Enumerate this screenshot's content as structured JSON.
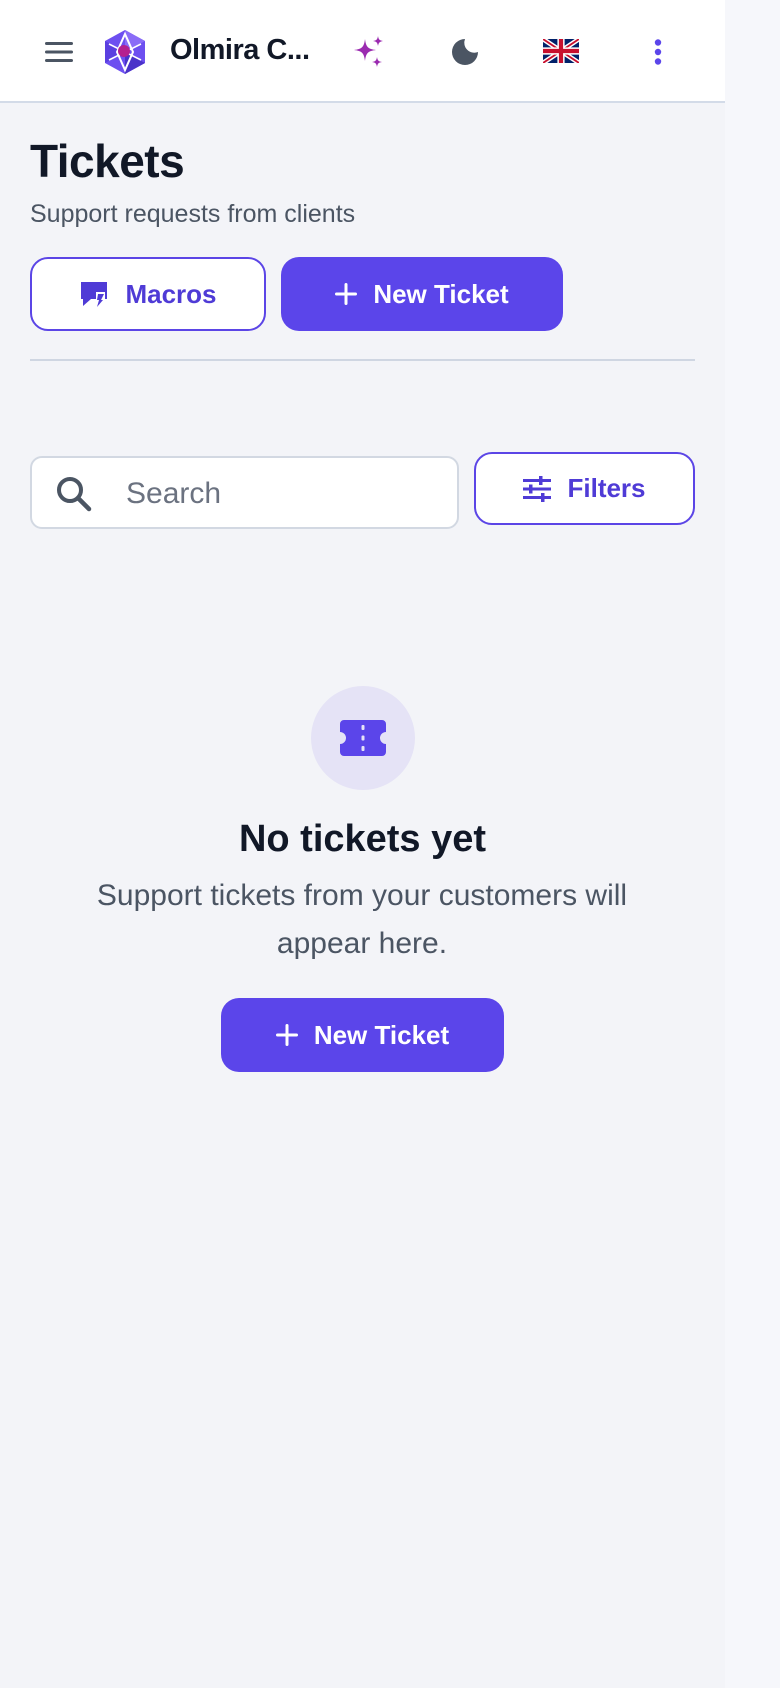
{
  "header": {
    "app_title": "Olmira C...",
    "icons": {
      "menu": "hamburger-menu-icon",
      "logo": "hexagon-logo-icon",
      "ai": "sparkle-icon",
      "theme": "moon-icon",
      "language": "uk-flag-icon",
      "more": "kebab-menu-icon"
    }
  },
  "page": {
    "title": "Tickets",
    "subtitle": "Support requests from clients"
  },
  "actions": {
    "macros_label": "Macros",
    "new_ticket_label": "New Ticket"
  },
  "search": {
    "placeholder": "Search",
    "value": ""
  },
  "filters": {
    "label": "Filters"
  },
  "empty_state": {
    "icon": "ticket-icon",
    "title": "No tickets yet",
    "description": "Support tickets from your customers will appear here.",
    "button_label": "New Ticket"
  },
  "colors": {
    "accent": "#5b45ea",
    "background": "#f3f4f8",
    "header_bg": "#ffffff",
    "sparkle": "#9b2bb0"
  }
}
